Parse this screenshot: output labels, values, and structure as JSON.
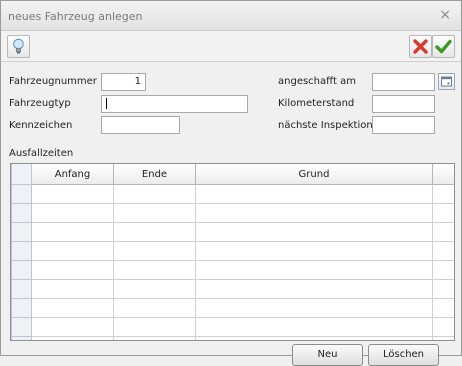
{
  "window": {
    "title": "neues Fahrzeug anlegen",
    "close_glyph": "×"
  },
  "toolbar": {
    "hint_icon": "lightbulb-icon",
    "cancel_icon": "red-x-icon",
    "confirm_icon": "green-check-icon"
  },
  "form": {
    "left": [
      {
        "label": "Fahrzeugnummer",
        "value": "1"
      },
      {
        "label": "Fahrzeugtyp",
        "value": ""
      },
      {
        "label": "Kennzeichen",
        "value": ""
      }
    ],
    "right": [
      {
        "label": "angeschafft am",
        "value": ""
      },
      {
        "label": "Kilometerstand",
        "value": ""
      },
      {
        "label": "nächste Inspektion",
        "value": ""
      }
    ]
  },
  "downtimes": {
    "section_label": "Ausfallzeiten",
    "columns": [
      "Anfang",
      "Ende",
      "Grund"
    ],
    "rows": [
      [
        "",
        "",
        ""
      ],
      [
        "",
        "",
        ""
      ],
      [
        "",
        "",
        ""
      ],
      [
        "",
        "",
        ""
      ],
      [
        "",
        "",
        ""
      ],
      [
        "",
        "",
        ""
      ],
      [
        "",
        "",
        ""
      ],
      [
        "",
        "",
        ""
      ],
      [
        "",
        "",
        ""
      ]
    ]
  },
  "buttons": {
    "new": "Neu",
    "delete": "Löschen"
  },
  "colors": {
    "cancel": "#d93a2b",
    "confirm": "#3e9a22",
    "title_text": "#7a7a7a"
  }
}
